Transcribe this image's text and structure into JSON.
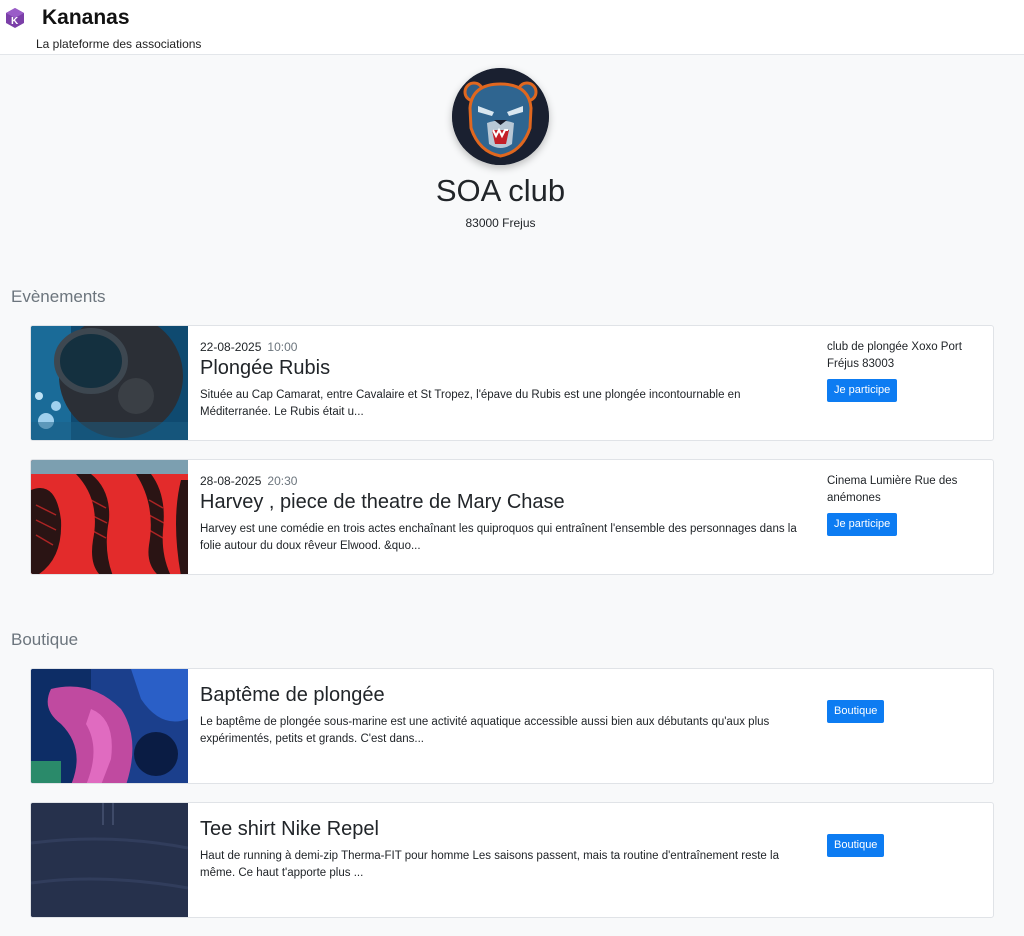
{
  "header": {
    "brand": "Kananas",
    "tagline": "La plateforme des associations"
  },
  "club": {
    "name": "SOA club",
    "location": "83000 Frejus"
  },
  "events_section": {
    "title": "Evènements",
    "items": [
      {
        "date": "22-08-2025",
        "time": "10:00",
        "title": "Plongée Rubis",
        "description": "Située au Cap Camarat, entre Cavalaire et St Tropez, l'épave du Rubis est une plongée incontournable en Méditerranée. Le Rubis était u...",
        "place": "club de plongée Xoxo Port Fréjus 83003",
        "button": "Je participe"
      },
      {
        "date": "28-08-2025",
        "time": "20:30",
        "title": "Harvey , piece de theatre de Mary Chase",
        "description": "Harvey est une comédie en trois actes enchaînant les quiproquos qui entraînent l'ensemble des personnages dans la folie autour du doux rêveur Elwood. &quo...",
        "place": "Cinema Lumière Rue des anémones",
        "button": "Je participe"
      }
    ]
  },
  "shop_section": {
    "title": "Boutique",
    "items": [
      {
        "title": "Baptême de plongée",
        "description": "Le baptême de plongée sous-marine est une activité aquatique accessible aussi bien aux débutants qu'aux plus expérimentés, petits et grands. C'est dans...",
        "button": "Boutique"
      },
      {
        "title": "Tee shirt Nike Repel",
        "description": "Haut de running à demi-zip Therma-FIT pour homme Les saisons passent, mais ta routine d'entraînement reste la même. Ce haut t'apporte plus ...",
        "button": "Boutique"
      }
    ]
  },
  "colors": {
    "accent": "#0d7cf2",
    "background": "#f8f9fa",
    "muted": "#6c757d"
  }
}
